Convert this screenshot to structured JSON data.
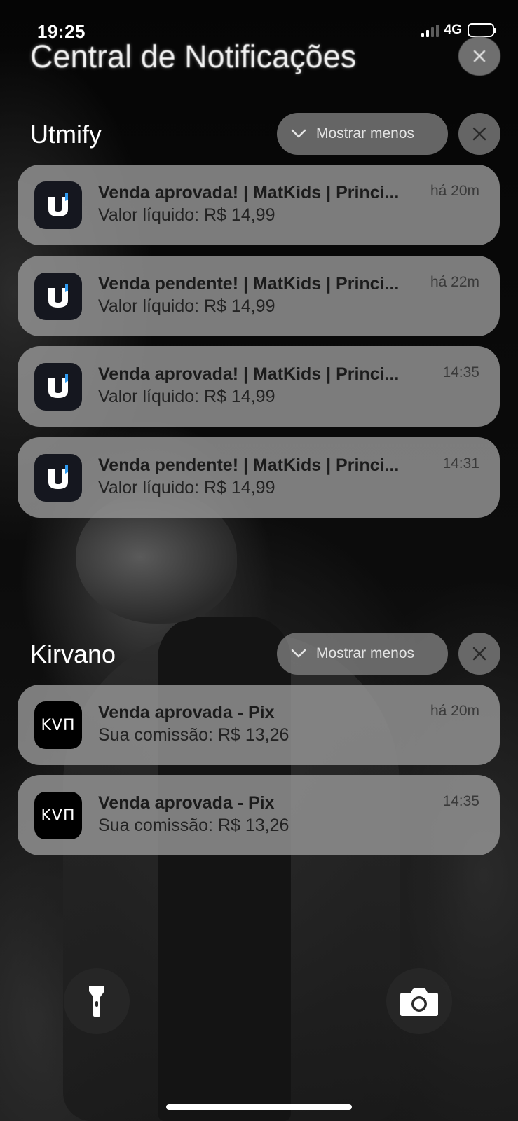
{
  "status_bar": {
    "time": "19:25",
    "network": "4G"
  },
  "header": {
    "title": "Central de Notificações"
  },
  "groups": [
    {
      "name": "Utmify",
      "collapse_label": "Mostrar menos",
      "icon": "utmify-app-icon",
      "notifications": [
        {
          "title": "Venda aprovada! | MatKids | Princi...",
          "body": "Valor líquido: R$ 14,99",
          "time": "há 20m"
        },
        {
          "title": "Venda pendente! | MatKids | Princi...",
          "body": "Valor líquido: R$ 14,99",
          "time": "há 22m"
        },
        {
          "title": "Venda aprovada! | MatKids | Princi...",
          "body": "Valor líquido: R$ 14,99",
          "time": "14:35"
        },
        {
          "title": "Venda pendente! | MatKids | Princi...",
          "body": "Valor líquido: R$ 14,99",
          "time": "14:31"
        }
      ]
    },
    {
      "name": "Kirvano",
      "collapse_label": "Mostrar menos",
      "icon": "kirvano-app-icon",
      "icon_text": "KVΠ",
      "notifications": [
        {
          "title": "Venda aprovada - Pix",
          "body": "Sua comissão: R$ 13,26",
          "time": "há 20m"
        },
        {
          "title": "Venda aprovada - Pix",
          "body": "Sua comissão: R$ 13,26",
          "time": "14:35"
        }
      ]
    }
  ],
  "icons": {
    "flashlight": "flashlight-icon",
    "camera": "camera-icon",
    "close": "close-icon",
    "chevron": "chevron-down-icon"
  },
  "colors": {
    "utmify_icon_bg": "#15171f",
    "utmify_accent": "#2f9bf0",
    "kirvano_icon_bg": "#000000"
  }
}
